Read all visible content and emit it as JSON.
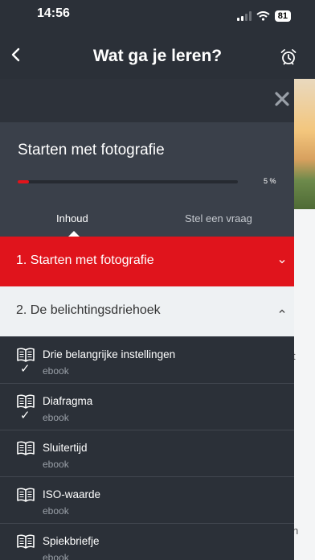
{
  "status_bar": {
    "time": "14:56",
    "battery": "81"
  },
  "nav": {
    "title": "Wat ga je leren?"
  },
  "course": {
    "title": "Starten met fotografie",
    "progress_percent": 5,
    "progress_label": "5 %",
    "tabs": [
      {
        "label": "Inhoud"
      },
      {
        "label": "Stel een vraag"
      }
    ]
  },
  "sections": [
    {
      "label": "1. Starten met fotografie",
      "state": "collapsed",
      "color": "#e0141c"
    },
    {
      "label": "2. De belichtingsdriehoek",
      "state": "expanded"
    }
  ],
  "lessons": [
    {
      "title": "Drie belangrijke instellingen",
      "type": "ebook",
      "check": "✓"
    },
    {
      "title": "Diafragma",
      "type": "ebook",
      "check": "✓"
    },
    {
      "title": "Sluitertijd",
      "type": "ebook",
      "check": ""
    },
    {
      "title": "ISO-waarde",
      "type": "ebook",
      "check": ""
    },
    {
      "title": "Spiekbriefje",
      "type": "ebook",
      "check": ""
    }
  ],
  "background": {
    "snippets": [
      "t",
      "n"
    ]
  }
}
